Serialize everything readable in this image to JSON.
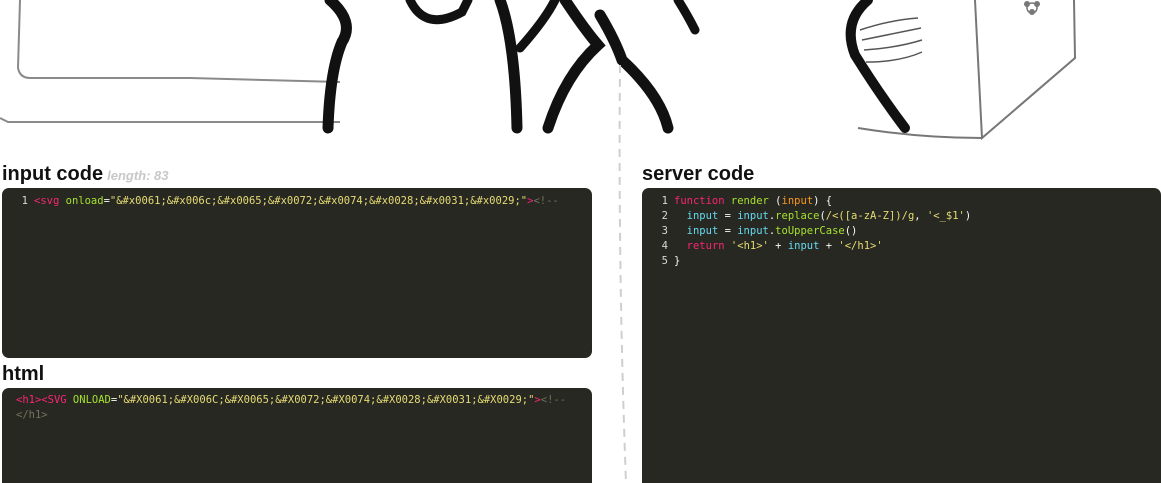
{
  "sections": {
    "input_title": "input code",
    "input_length": "length: 83",
    "html_title": "html",
    "server_title": "server code"
  },
  "input_code": {
    "lines": [
      {
        "number": "1",
        "tokens": [
          {
            "type": "tag",
            "text": "<"
          },
          {
            "type": "tag",
            "text": "svg"
          },
          {
            "type": "plain",
            "text": " "
          },
          {
            "type": "attr",
            "text": "onload"
          },
          {
            "type": "plain",
            "text": "="
          },
          {
            "type": "str",
            "text": "\"&#x0061;&#x006c;&#x0065;&#x0072;&#x0074;&#x0028;&#x0031;&#x0029;\""
          },
          {
            "type": "tag",
            "text": ">"
          },
          {
            "type": "cmt",
            "text": "<!--"
          }
        ]
      }
    ]
  },
  "html_output": {
    "lines": [
      {
        "tokens": [
          {
            "type": "tag",
            "text": "<h1>"
          },
          {
            "type": "tag",
            "text": "<SVG"
          },
          {
            "type": "plain",
            "text": " "
          },
          {
            "type": "attr",
            "text": "ONLOAD"
          },
          {
            "type": "plain",
            "text": "="
          },
          {
            "type": "str",
            "text": "\"&#X0061;&#X006C;&#X0065;&#X0072;&#X0074;&#X0028;&#X0031;&#X0029;\""
          },
          {
            "type": "tag",
            "text": ">"
          },
          {
            "type": "cmt",
            "text": "<!--"
          }
        ]
      },
      {
        "tokens": [
          {
            "type": "cmt",
            "text": "</h1>"
          }
        ]
      }
    ]
  },
  "server_code": {
    "lines": [
      {
        "number": "1",
        "tokens": [
          {
            "type": "kw",
            "text": "function"
          },
          {
            "type": "plain",
            "text": " "
          },
          {
            "type": "fn",
            "text": "render"
          },
          {
            "type": "plain",
            "text": " ("
          },
          {
            "type": "param",
            "text": "input"
          },
          {
            "type": "plain",
            "text": ") {"
          }
        ]
      },
      {
        "number": "2",
        "tokens": [
          {
            "type": "plain",
            "text": "  "
          },
          {
            "type": "var",
            "text": "input"
          },
          {
            "type": "plain",
            "text": " = "
          },
          {
            "type": "var",
            "text": "input"
          },
          {
            "type": "plain",
            "text": "."
          },
          {
            "type": "fn",
            "text": "replace"
          },
          {
            "type": "plain",
            "text": "("
          },
          {
            "type": "str",
            "text": "/<([a-zA-Z])/g"
          },
          {
            "type": "plain",
            "text": ", "
          },
          {
            "type": "str",
            "text": "'<_$1'"
          },
          {
            "type": "plain",
            "text": ")"
          }
        ]
      },
      {
        "number": "3",
        "tokens": [
          {
            "type": "plain",
            "text": "  "
          },
          {
            "type": "var",
            "text": "input"
          },
          {
            "type": "plain",
            "text": " = "
          },
          {
            "type": "var",
            "text": "input"
          },
          {
            "type": "plain",
            "text": "."
          },
          {
            "type": "fn",
            "text": "toUpperCase"
          },
          {
            "type": "plain",
            "text": "()"
          }
        ]
      },
      {
        "number": "4",
        "tokens": [
          {
            "type": "plain",
            "text": "  "
          },
          {
            "type": "kw",
            "text": "return"
          },
          {
            "type": "plain",
            "text": " "
          },
          {
            "type": "str",
            "text": "'<h1>'"
          },
          {
            "type": "plain",
            "text": " + "
          },
          {
            "type": "var",
            "text": "input"
          },
          {
            "type": "plain",
            "text": " + "
          },
          {
            "type": "str",
            "text": "'</h1>'"
          }
        ]
      },
      {
        "number": "5",
        "tokens": [
          {
            "type": "plain",
            "text": "}"
          }
        ]
      }
    ]
  },
  "colors": {
    "editor_background": "#272822",
    "tag": "#f92672",
    "attribute": "#a6e22e",
    "string": "#e6db74",
    "comment": "#75715e",
    "variable": "#66d9ef",
    "parameter": "#fd971f"
  },
  "illustration": {
    "icon": "cartoon-characters-illustration"
  }
}
